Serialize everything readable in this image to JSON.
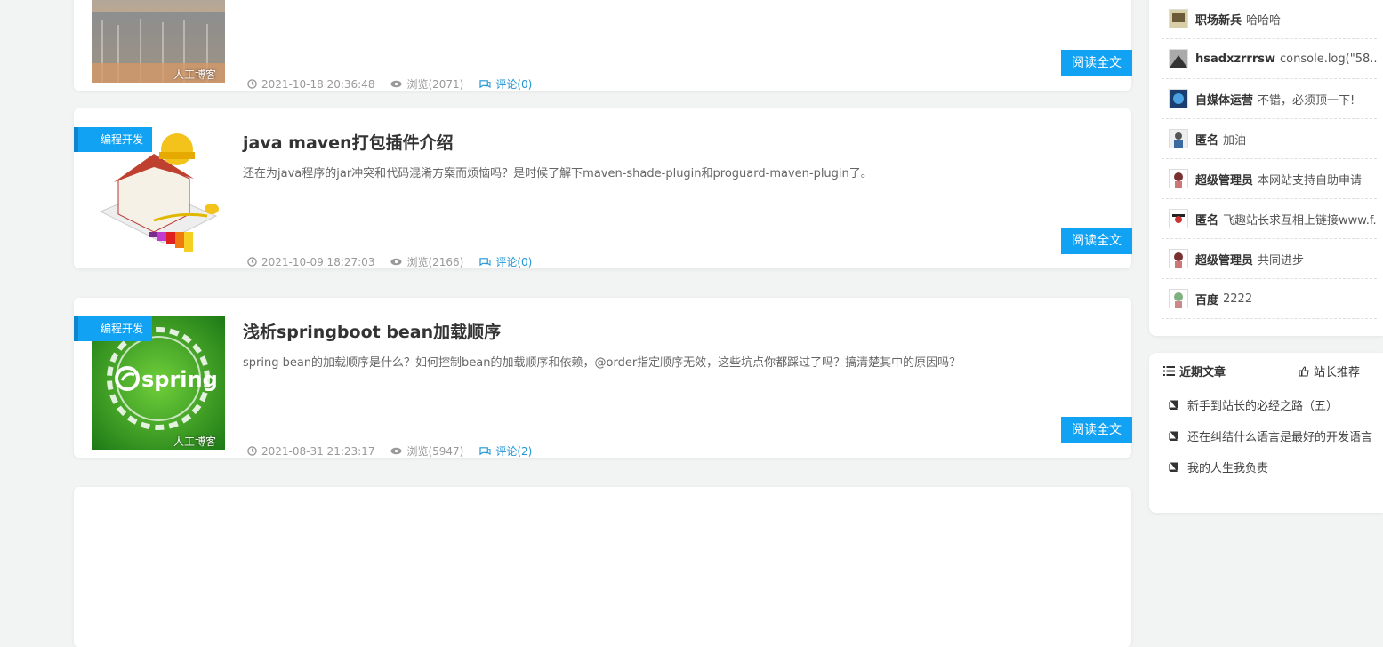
{
  "posts": [
    {
      "category": "",
      "title": "",
      "excerpt": "",
      "watermark": "人工博客",
      "date": "2021-10-18 20:36:48",
      "views": "浏览(2071)",
      "comments": "评论(0)",
      "read_label": "阅读全文"
    },
    {
      "category": "编程开发",
      "title": "java maven打包插件介绍",
      "excerpt": "还在为java程序的jar冲突和代码混淆方案而烦恼吗？是时候了解下maven-shade-plugin和proguard-maven-plugin了。",
      "watermark": "",
      "date": "2021-10-09 18:27:03",
      "views": "浏览(2166)",
      "comments": "评论(0)",
      "read_label": "阅读全文"
    },
    {
      "category": "编程开发",
      "title": "浅析springboot bean加载顺序",
      "excerpt": "spring bean的加载顺序是什么？如何控制bean的加载顺序和依赖，@order指定顺序无效，这些坑点你都踩过了吗？搞清楚其中的原因吗？",
      "watermark": "人工博客",
      "thumb_text": "spring",
      "date": "2021-08-31 21:23:17",
      "views": "浏览(5947)",
      "comments": "评论(2)",
      "read_label": "阅读全文"
    }
  ],
  "recent_comments": [
    {
      "user": "职场新兵",
      "text": "哈哈哈"
    },
    {
      "user": "hsadxzrrrsw",
      "text": "console.log(\"58..."
    },
    {
      "user": "自媒体运营",
      "text": "不错，必须顶一下!"
    },
    {
      "user": "匿名",
      "text": "加油"
    },
    {
      "user": "超级管理员",
      "text": "本网站支持自助申请"
    },
    {
      "user": "匿名",
      "text": "飞趣站长求互相上链接www.f..."
    },
    {
      "user": "超级管理员",
      "text": "共同进步"
    },
    {
      "user": "百度",
      "text": "2222"
    }
  ],
  "tabs": {
    "recent": "近期文章",
    "recommend": "站长推荐"
  },
  "recent_articles": [
    "新手到站长的必经之路（五）",
    "还在纠结什么语言是最好的开发语言",
    "我的人生我负责"
  ],
  "colors": {
    "accent": "#12a2f3",
    "link": "#2196d6",
    "page_bg": "#f2f4f4"
  }
}
